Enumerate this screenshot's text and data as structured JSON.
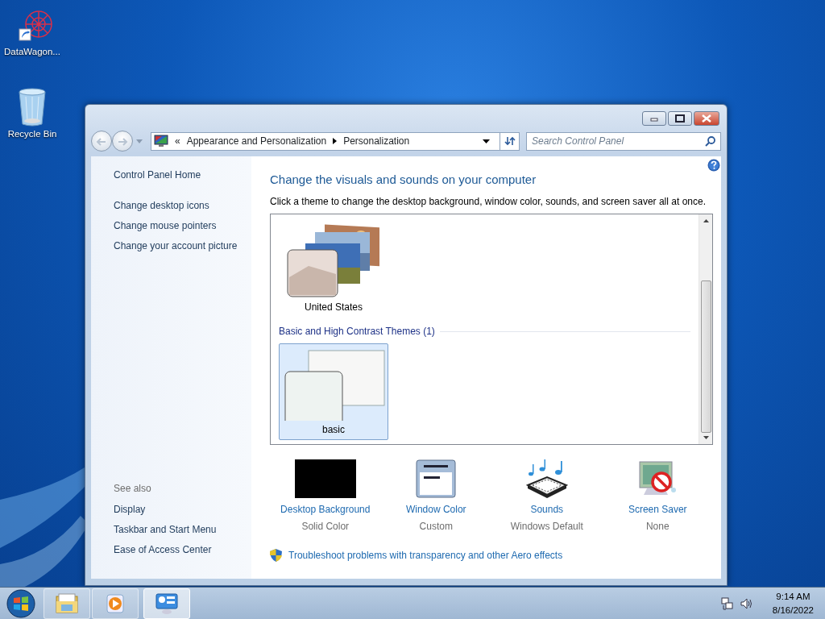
{
  "desktop_icons": [
    {
      "kind": "shortcut",
      "label": "DataWagon..."
    },
    {
      "kind": "recycle-bin",
      "label": "Recycle Bin"
    }
  ],
  "window": {
    "breadcrumb_overflow": "«",
    "breadcrumb": [
      "Appearance and Personalization",
      "Personalization"
    ],
    "search": {
      "placeholder": "Search Control Panel"
    },
    "sidebar": {
      "links": [
        "Control Panel Home",
        "Change desktop icons",
        "Change mouse pointers",
        "Change your account picture"
      ],
      "see_also_title": "See also",
      "see_also": [
        "Display",
        "Taskbar and Start Menu",
        "Ease of Access Center"
      ]
    },
    "heading": "Change the visuals and sounds on your computer",
    "intro": "Click a theme to change the desktop background, window color, sounds, and screen saver all at once.",
    "theme_groups": [
      {
        "themes": [
          {
            "kind": "photos",
            "name": "United States",
            "selected": false
          }
        ]
      },
      {
        "title": "Basic and High Contrast Themes (1)",
        "themes": [
          {
            "kind": "basic",
            "name": "basic",
            "selected": true
          }
        ]
      }
    ],
    "settings": [
      {
        "kind": "background",
        "label": "Desktop Background",
        "value": "Solid Color"
      },
      {
        "kind": "window-color",
        "label": "Window Color",
        "value": "Custom"
      },
      {
        "kind": "sounds",
        "label": "Sounds",
        "value": "Windows Default"
      },
      {
        "kind": "screen-saver",
        "label": "Screen Saver",
        "value": "None"
      }
    ],
    "troubleshoot_link": "Troubleshoot problems with transparency and other Aero effects"
  },
  "taskbar": {
    "items": [
      {
        "kind": "explorer",
        "selected": false
      },
      {
        "kind": "media",
        "selected": false
      },
      {
        "kind": "control-panel",
        "selected": true
      }
    ],
    "time": "9:14 AM",
    "date": "8/16/2022"
  }
}
